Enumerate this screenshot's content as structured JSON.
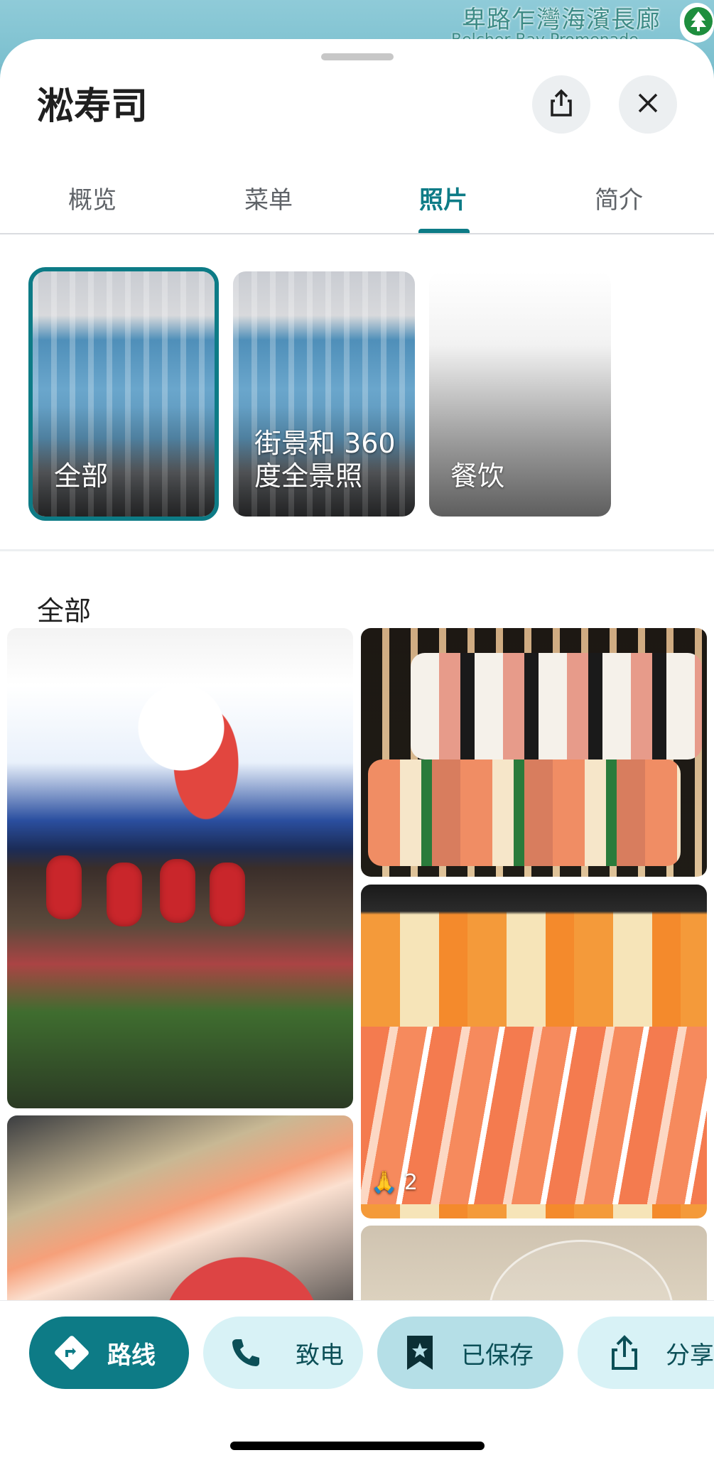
{
  "map": {
    "label_primary": "卑路乍灣海濱長廊",
    "label_secondary": "Belcher Bay Promenade",
    "pin_icon": "tree-icon"
  },
  "header": {
    "title": "淞寿司",
    "share_icon": "share-icon",
    "close_icon": "close-icon"
  },
  "tabs": [
    {
      "label": "概览"
    },
    {
      "label": "菜单"
    },
    {
      "label": "照片",
      "active": true
    },
    {
      "label": "简介"
    }
  ],
  "categories": [
    {
      "label": "全部",
      "selected": true
    },
    {
      "label": "街景和 360 度全景照"
    },
    {
      "label": "餐饮"
    }
  ],
  "section": {
    "title": "全部"
  },
  "photos": [
    {
      "name": "storefront-photo"
    },
    {
      "name": "sushi-platter-photo"
    },
    {
      "name": "sashimi-photo",
      "reaction_count": "2",
      "reaction_icon": "clap-icon"
    },
    {
      "name": "salmon-udon-photo"
    },
    {
      "name": "cup-photo"
    }
  ],
  "actions": {
    "route": "路线",
    "call": "致电",
    "saved": "已保存",
    "share": "分享"
  },
  "colors": {
    "accent": "#0d7b86",
    "chip_light": "#d8f2f6",
    "chip_saved": "#b5dfe7"
  }
}
